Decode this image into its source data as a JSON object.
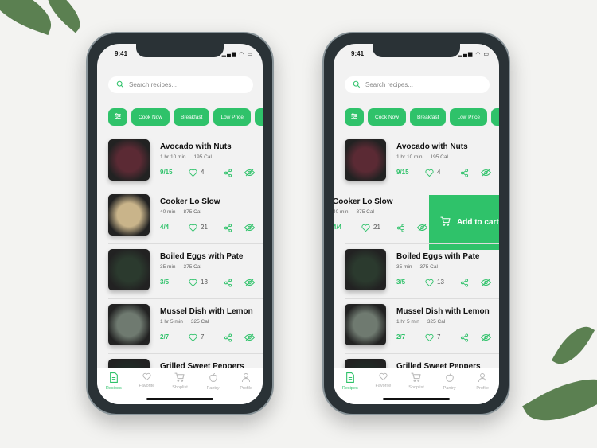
{
  "colors": {
    "accent": "#2fc26a",
    "background": "#f3f3f1"
  },
  "phones": [
    {
      "status_time": "9:41",
      "search_placeholder": "Search recipes...",
      "chips": [
        "Cook Now",
        "Breakfast",
        "Low Price"
      ],
      "recipes": [
        {
          "title": "Avocado with Nuts",
          "time": "1 hr 10 min",
          "cal": "195 Cal",
          "progress": "9/15",
          "likes": "4",
          "img": "#5b2a34"
        },
        {
          "title": "Cooker Lo Slow",
          "time": "40 min",
          "cal": "875 Cal",
          "progress": "4/4",
          "likes": "21",
          "img": "#c9b48a"
        },
        {
          "title": "Boiled Eggs with Pate",
          "time": "35 min",
          "cal": "375 Cal",
          "progress": "3/5",
          "likes": "13",
          "img": "#2b3a2e"
        },
        {
          "title": "Mussel Dish with Lemon",
          "time": "1 hr 5 min",
          "cal": "325 Cal",
          "progress": "2/7",
          "likes": "7",
          "img": "#6f7a70"
        },
        {
          "title": "Grilled Sweet Peppers",
          "time": "",
          "cal": "",
          "progress": "",
          "likes": "",
          "img": "#1f2a25"
        }
      ],
      "tabs": [
        {
          "label": "Recipes",
          "icon": "document-icon",
          "active": true
        },
        {
          "label": "Favorite",
          "icon": "heart-icon"
        },
        {
          "label": "Shoplist",
          "icon": "cart-icon"
        },
        {
          "label": "Pantry",
          "icon": "apple-icon"
        },
        {
          "label": "Profile",
          "icon": "person-icon"
        }
      ]
    },
    {
      "status_time": "9:41",
      "search_placeholder": "Search recipes...",
      "chips": [
        "Cook Now",
        "Breakfast",
        "Low Price"
      ],
      "recipes": [
        {
          "title": "Avocado with Nuts",
          "time": "1 hr 10 min",
          "cal": "195 Cal",
          "progress": "9/15",
          "likes": "4",
          "img": "#5b2a34"
        },
        {
          "title": "Cooker Lo Slow",
          "time": "40 min",
          "cal": "875 Cal",
          "progress": "4/4",
          "likes": "21",
          "img": "#c9b48a",
          "swiped": true
        },
        {
          "title": "Boiled Eggs with Pate",
          "time": "35 min",
          "cal": "375 Cal",
          "progress": "3/5",
          "likes": "13",
          "img": "#2b3a2e"
        },
        {
          "title": "Mussel Dish with Lemon",
          "time": "1 hr 5 min",
          "cal": "325 Cal",
          "progress": "2/7",
          "likes": "7",
          "img": "#6f7a70"
        },
        {
          "title": "Grilled Sweet Peppers",
          "time": "",
          "cal": "",
          "progress": "",
          "likes": "",
          "img": "#1f2a25"
        }
      ],
      "swipe_action": "Add to cart",
      "tabs": [
        {
          "label": "Recipes",
          "icon": "document-icon",
          "active": true
        },
        {
          "label": "Favorite",
          "icon": "heart-icon"
        },
        {
          "label": "Shoplist",
          "icon": "cart-icon"
        },
        {
          "label": "Pantry",
          "icon": "apple-icon"
        },
        {
          "label": "Profile",
          "icon": "person-icon"
        }
      ]
    }
  ]
}
